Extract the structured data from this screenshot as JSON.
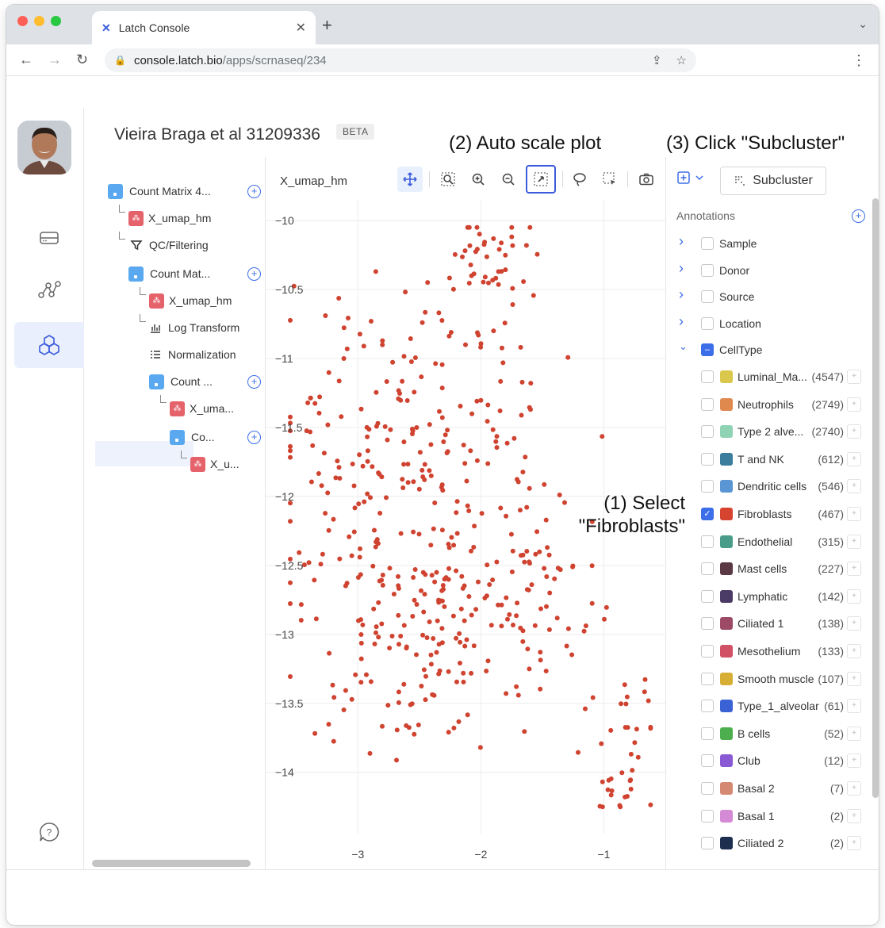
{
  "browser": {
    "tab_title": "Latch Console",
    "url_host": "console.latch.bio",
    "url_path": "/apps/scrnaseq/234"
  },
  "page": {
    "title": "Vieira Braga et al 31209336",
    "badge": "BETA"
  },
  "annotations": {
    "step1_line1": "(1) Select",
    "step1_line2": "\"Fibroblasts\"",
    "step2": "(2) Auto scale plot",
    "step3": "(3) Click \"Subcluster\""
  },
  "tree": [
    {
      "label": "Count Matrix 4...",
      "kind": "matrix",
      "add": true
    },
    {
      "label": "X_umap_hm",
      "kind": "embedding"
    },
    {
      "label": "QC/Filtering",
      "kind": "filter"
    },
    {
      "label": "Count Mat...",
      "kind": "matrix",
      "add": true
    },
    {
      "label": "X_umap_hm",
      "kind": "embedding"
    },
    {
      "label": "Log Transform",
      "kind": "transform"
    },
    {
      "label": "Normalization",
      "kind": "normalize"
    },
    {
      "label": "Count ...",
      "kind": "matrix",
      "add": true
    },
    {
      "label": "X_uma...",
      "kind": "embedding"
    },
    {
      "label": "Co...",
      "kind": "matrix",
      "add": true
    },
    {
      "label": "X_u...",
      "kind": "embedding",
      "selected": true
    }
  ],
  "plot": {
    "title": "X_umap_hm",
    "tools": [
      "pan-icon",
      "zoom-box-icon",
      "zoom-in-icon",
      "zoom-out-icon",
      "autoscale-icon",
      "lasso-icon",
      "box-select-icon",
      "camera-icon"
    ],
    "point_color": "#cf4330"
  },
  "chart_data": {
    "type": "scatter",
    "x_ticks": [
      -3,
      -2,
      -1
    ],
    "y_ticks": [
      -10,
      -10.5,
      -11,
      -11.5,
      -12,
      -12.5,
      -13,
      -13.5,
      -14
    ],
    "xlim": [
      -3.75,
      -0.5
    ],
    "ylim": [
      -14.45,
      -9.85
    ],
    "grid": true,
    "color": "#cf4330"
  },
  "right_panel": {
    "subcluster_label": "Subcluster",
    "annotations_title": "Annotations",
    "groups": [
      {
        "label": "Sample",
        "expanded": false
      },
      {
        "label": "Donor",
        "expanded": false
      },
      {
        "label": "Source",
        "expanded": false
      },
      {
        "label": "Location",
        "expanded": false
      },
      {
        "label": "CellType",
        "expanded": true
      }
    ],
    "cell_types": [
      {
        "label": "Luminal_Ma...",
        "count": "(4547)",
        "color": "#d9c84c",
        "checked": false
      },
      {
        "label": "Neutrophils",
        "count": "(2749)",
        "color": "#e0894e",
        "checked": false
      },
      {
        "label": "Type 2 alve...",
        "count": "(2740)",
        "color": "#8fd3b4",
        "checked": false
      },
      {
        "label": "T and NK",
        "count": "(612)",
        "color": "#3c7c9c",
        "checked": false
      },
      {
        "label": "Dendritic cells",
        "count": "(546)",
        "color": "#5a96d4",
        "checked": false
      },
      {
        "label": "Fibroblasts",
        "count": "(467)",
        "color": "#d6432f",
        "checked": true
      },
      {
        "label": "Endothelial",
        "count": "(315)",
        "color": "#4a9c8a",
        "checked": false
      },
      {
        "label": "Mast cells",
        "count": "(227)",
        "color": "#5a3844",
        "checked": false
      },
      {
        "label": "Lymphatic",
        "count": "(142)",
        "color": "#4a3a66",
        "checked": false
      },
      {
        "label": "Ciliated 1",
        "count": "(138)",
        "color": "#9c4a66",
        "checked": false
      },
      {
        "label": "Mesothelium",
        "count": "(133)",
        "color": "#d25066",
        "checked": false
      },
      {
        "label": "Smooth muscle",
        "count": "(107)",
        "color": "#d6ae34",
        "checked": false
      },
      {
        "label": "Type_1_alveolar",
        "count": "(61)",
        "color": "#3b62d4",
        "checked": false
      },
      {
        "label": "B cells",
        "count": "(52)",
        "color": "#4cae4c",
        "checked": false
      },
      {
        "label": "Club",
        "count": "(12)",
        "color": "#8a5ad4",
        "checked": false
      },
      {
        "label": "Basal 2",
        "count": "(7)",
        "color": "#d48a72",
        "checked": false
      },
      {
        "label": "Basal 1",
        "count": "(2)",
        "color": "#d48ad4",
        "checked": false
      },
      {
        "label": "Ciliated 2",
        "count": "(2)",
        "color": "#1e2e4e",
        "checked": false
      }
    ]
  }
}
